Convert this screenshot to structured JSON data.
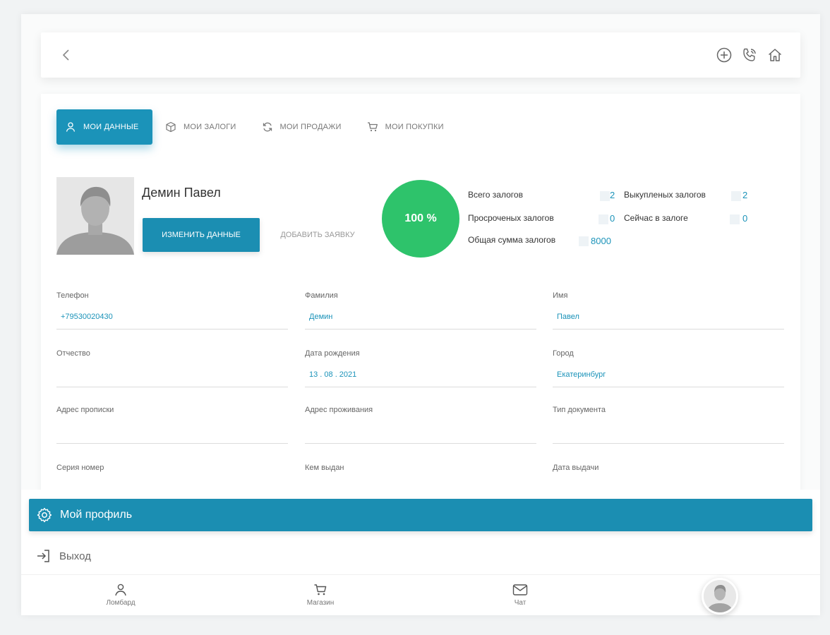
{
  "tabs": [
    {
      "label": "Мои данные",
      "icon": "user-icon",
      "active": true
    },
    {
      "label": "Мои залоги",
      "icon": "cube-icon",
      "active": false
    },
    {
      "label": "Мои продажи",
      "icon": "refresh-icon",
      "active": false
    },
    {
      "label": "Мои покупки",
      "icon": "cart-icon",
      "active": false
    }
  ],
  "profile": {
    "name": "Демин Павел",
    "edit_label": "Изменить данные",
    "add_label": "Добавить заявку",
    "rating": "100 %",
    "rating_color": "#2ec36b"
  },
  "stats": {
    "total_label": "Всего залогов",
    "total_value": "2",
    "redeemed_label": "Выкупленых залогов",
    "redeemed_value": "2",
    "overdue_label": "Просроченых залогов",
    "overdue_value": "0",
    "now_label": "Сейчас в залоге",
    "now_value": "0",
    "sum_label": "Общая сумма залогов",
    "sum_value": "8000"
  },
  "fields": {
    "phone": {
      "label": "Телефон",
      "value": "+79530020430"
    },
    "surname": {
      "label": "Фамилия",
      "value": "Демин"
    },
    "firstname": {
      "label": "Имя",
      "value": "Павел"
    },
    "patronymic": {
      "label": "Отчество",
      "value": ""
    },
    "birthdate": {
      "label": "Дата рождения",
      "value": "13 . 08 . 2021"
    },
    "city": {
      "label": "Город",
      "value": "Екатеринбург"
    },
    "reg_address": {
      "label": "Адрес прописки",
      "value": ""
    },
    "live_address": {
      "label": "Адрес проживания",
      "value": ""
    },
    "doc_type": {
      "label": "Тип документа",
      "value": ""
    },
    "series": {
      "label": "Серия номер",
      "value": ""
    },
    "issued_by": {
      "label": "Кем выдан",
      "value": ""
    },
    "issue_date": {
      "label": "Дата выдачи",
      "value": ""
    }
  },
  "menu": {
    "profile_label": "Мой профиль",
    "exit_label": "Выход"
  },
  "nav": {
    "lombard": "Ломбард",
    "shop": "Магазин",
    "chat": "Чат"
  },
  "colors": {
    "accent": "#1b8eb2",
    "success": "#2ec36b"
  }
}
